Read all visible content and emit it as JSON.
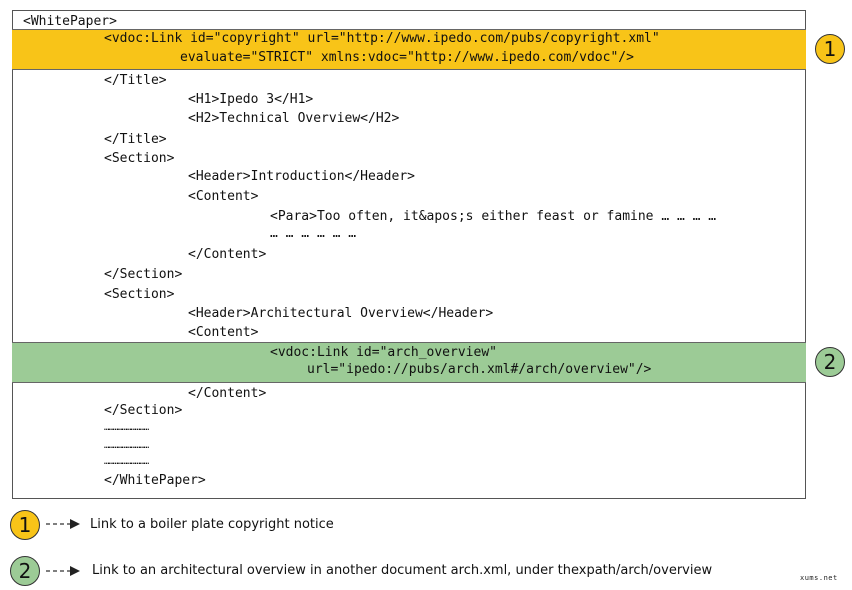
{
  "code": {
    "l01": "<WhitePaper>",
    "l02": "<vdoc:Link id=\"copyright\" url=\"http://www.ipedo.com/pubs/copyright.xml\"",
    "l03": "evaluate=\"STRICT\" xmlns:vdoc=\"http://www.ipedo.com/vdoc\"/>",
    "l04": "</Title>",
    "l05": "<H1>Ipedo 3</H1>",
    "l06": "<H2>Technical Overview</H2>",
    "l07": "</Title>",
    "l08": "<Section>",
    "l09": "<Header>Introduction</Header>",
    "l10": "<Content>",
    "l11": "<Para>Too often, it&apos;s either feast or famine … … … …",
    "l12": "… … … … … …",
    "l13": "</Content>",
    "l14": "</Section>",
    "l15": "<Section>",
    "l16": "<Header>Architectural Overview</Header>",
    "l17": "<Content>",
    "l18": "<vdoc:Link id=\"arch_overview\"",
    "l19": "url=\"ipedo://pubs/arch.xml#/arch/overview\"/>",
    "l20": "</Content>",
    "l21": "</Section>",
    "l22": "…………………………",
    "l23": "…………………………",
    "l24": "…………………………",
    "l25": "</WhitePaper>"
  },
  "badges": {
    "one": "1",
    "two": "2"
  },
  "legend": {
    "one_number": "1",
    "one_text": "Link to a boiler plate copyright notice",
    "two_number": "2",
    "two_text": "Link to an architectural overview in another document arch.xml, under thexpath/arch/overview"
  },
  "watermark": "xums.net",
  "colors": {
    "highlight_yellow": "#f8c418",
    "highlight_green": "#9ccb96"
  }
}
